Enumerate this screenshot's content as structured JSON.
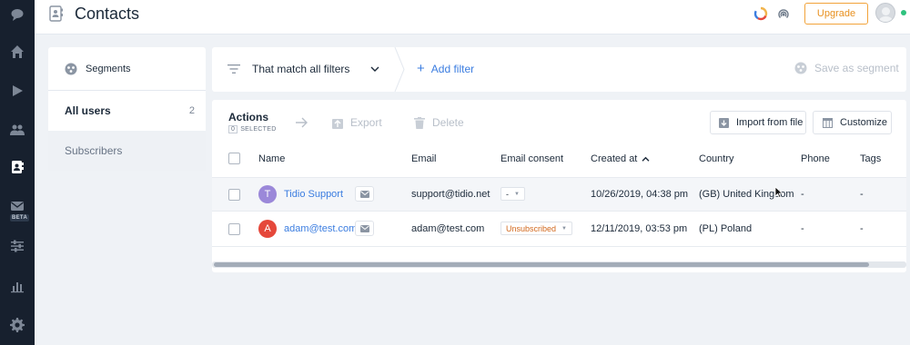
{
  "sidebar": {
    "icons": [
      "chat-icon",
      "home-icon",
      "play-icon",
      "visitors-icon",
      "contacts-icon",
      "mail-icon",
      "sliders-icon",
      "analytics-icon",
      "settings-icon"
    ],
    "beta_badge": "BETA"
  },
  "header": {
    "title": "Contacts",
    "upgrade_label": "Upgrade"
  },
  "segments": {
    "header_label": "Segments",
    "items": [
      {
        "label": "All users",
        "count": "2"
      },
      {
        "label": "Subscribers",
        "count": ""
      }
    ]
  },
  "filters": {
    "match_label": "That match all filters",
    "add_filter_label": "Add filter",
    "save_segment_label": "Save as segment"
  },
  "actions": {
    "title": "Actions",
    "selected_count": "0",
    "selected_label": "SELECTED",
    "export_label": "Export",
    "delete_label": "Delete",
    "import_label": "Import from file",
    "customize_label": "Customize"
  },
  "table": {
    "columns": [
      "Name",
      "Email",
      "Email consent",
      "Created at",
      "Country",
      "Phone",
      "Tags"
    ],
    "rows": [
      {
        "initial": "T",
        "avatar_color": "#9b88d9",
        "name": "Tidio Support",
        "email": "support@tidio.net",
        "consent": "-",
        "created_at": "10/26/2019, 04:38 pm",
        "country": "(GB) United Kingdom",
        "phone": "-",
        "tags": "-"
      },
      {
        "initial": "A",
        "avatar_color": "#e5483b",
        "name": "adam@test.com",
        "email": "adam@test.com",
        "consent": "Unsubscribed",
        "created_at": "12/11/2019, 03:53 pm",
        "country": "(PL) Poland",
        "phone": "-",
        "tags": "-"
      }
    ]
  },
  "colors": {
    "accent": "#3b7de0",
    "upgrade": "#e8901f",
    "sidebar_bg": "#17202e",
    "unsubscribed": "#d2691e",
    "online": "#2ec27e"
  }
}
